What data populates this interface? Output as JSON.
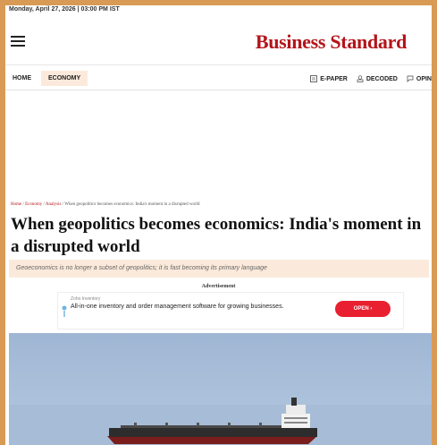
{
  "dateline": "Monday, April 27, 2026 | 03:00 PM IST",
  "header": {
    "logo": "Business Standard"
  },
  "nav": {
    "home": "HOME",
    "economy": "ECONOMY",
    "epaper": "E-PAPER",
    "decoded": "DECODED",
    "opinion": "OPIN"
  },
  "breadcrumb": {
    "home": "Home",
    "economy": "Economy",
    "analysis": "Analysis",
    "current": "When geopolitics becomes economics: India's moment in a disrupted world"
  },
  "article": {
    "headline": "When geopolitics becomes economics: India's moment in a disrupted world",
    "subhead": "Geoeconomics is no longer a subset of geopolitics; it is fast becoming its primary language"
  },
  "ad": {
    "label": "Advertisement",
    "brand": "Zoho Inventory",
    "text": "All-in-one inventory and order management software for growing businesses.",
    "button": "OPEN ›"
  },
  "colors": {
    "brand_red": "#b3141a",
    "accent_bg": "#fbeadb",
    "frame": "#d99a55",
    "ad_button": "#e8202f"
  }
}
